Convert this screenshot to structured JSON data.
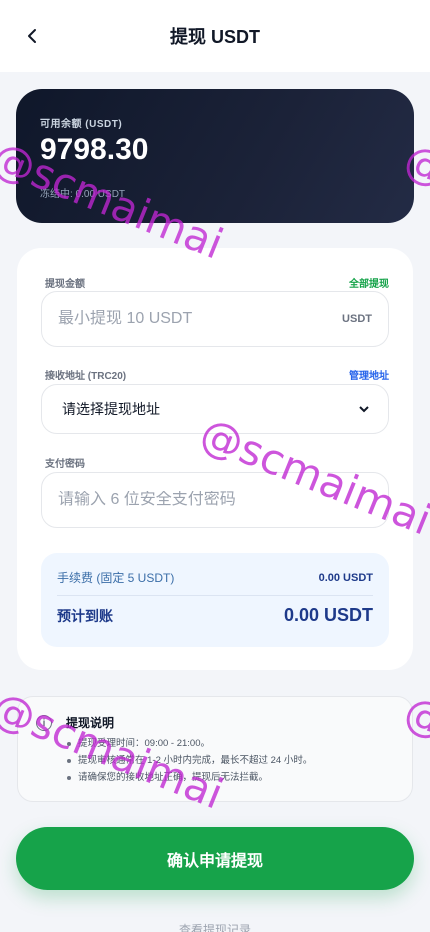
{
  "header": {
    "title": "提现 USDT"
  },
  "balance": {
    "label": "可用余额 (USDT)",
    "value": "9798.30",
    "frozen_text": "冻结中: 0.00 USDT"
  },
  "form": {
    "amount": {
      "label": "提现金额",
      "link": "全部提现",
      "placeholder": "最小提现 10 USDT",
      "unit": "USDT"
    },
    "address": {
      "label": "接收地址 (TRC20)",
      "link": "管理地址",
      "selected": "请选择提现地址"
    },
    "password": {
      "label": "支付密码",
      "placeholder": "请输入 6 位安全支付密码"
    }
  },
  "summary": {
    "fee_label": "手续费 (固定 5 USDT)",
    "fee_value": "0.00 USDT",
    "arrival_label": "预计到账",
    "arrival_value": "0.00 USDT"
  },
  "notice": {
    "title": "提现说明",
    "items": [
      "提现受理时间：09:00 - 21:00。",
      "提现审核通常在 1-2 小时内完成，最长不超过 24 小时。",
      "请确保您的接收地址正确，提现后无法拦截。"
    ]
  },
  "submit_label": "确认申请提现",
  "history_label": "查看提现记录",
  "watermark": "@scmaimai",
  "colors": {
    "accent_green": "#16a34a",
    "link_green": "#16a34a",
    "link_blue": "#2563eb",
    "card_dark": "#0f172a",
    "summary_bg": "#eff6ff",
    "watermark": "#c026d3"
  }
}
